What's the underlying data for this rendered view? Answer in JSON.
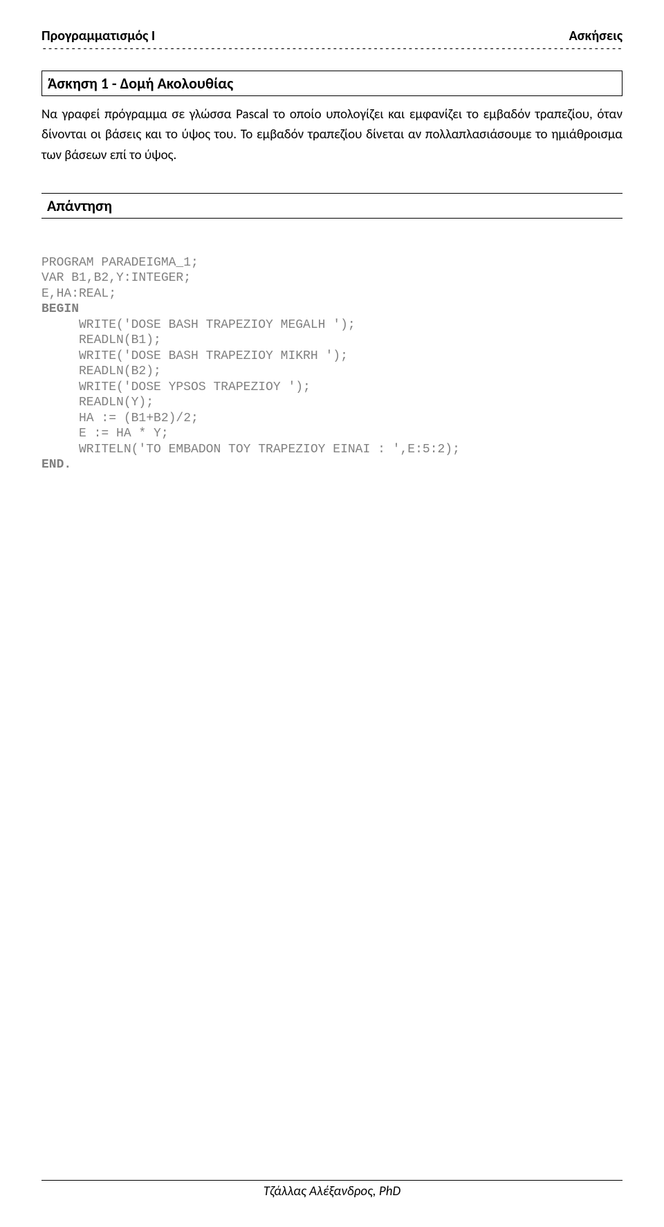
{
  "header": {
    "left": "Προγραμματισμός Ι",
    "right": "Ασκήσεις",
    "dashes": "------------------------------------------------------------------------------------------------------------------------"
  },
  "exercise": {
    "title": "Άσκηση 1 - Δομή Ακολουθίας",
    "body": "Να γραφεί πρόγραμμα σε γλώσσα Pascal το οποίο υπολογίζει και εμφανίζει το εμβαδόν τραπεζίου, όταν δίνονται οι βάσεις και το ύψος του. Το εμβαδόν τραπεζίου δίνεται αν πολλαπλασιάσουμε το ημιάθροισμα των βάσεων επί το ύψος."
  },
  "answer": {
    "label": "Απάντηση"
  },
  "code": {
    "line1": "PROGRAM PARADEIGMA_1;",
    "line2": "VAR B1,B2,Y:INTEGER;",
    "line3": "E,HA:REAL;",
    "begin": "BEGIN",
    "line5": "     WRITE('DOSE BASH TRAPEZIOY MEGALH ');",
    "line6": "     READLN(B1);",
    "line7": "     WRITE('DOSE BASH TRAPEZIOY MIKRH ');",
    "line8": "     READLN(B2);",
    "line9": "     WRITE('DOSE YPSOS TRAPEZIOY ');",
    "line10": "     READLN(Y);",
    "line11": "     HA := (B1+B2)/2;",
    "line12": "     E := HA * Y;",
    "line13": "     WRITELN('TO EMBADON TOY TRAPEZIOY EINAI : ',E:5:2);",
    "end": "END."
  },
  "footer": {
    "text": "Τζάλλας Αλέξανδρος, PhD"
  }
}
